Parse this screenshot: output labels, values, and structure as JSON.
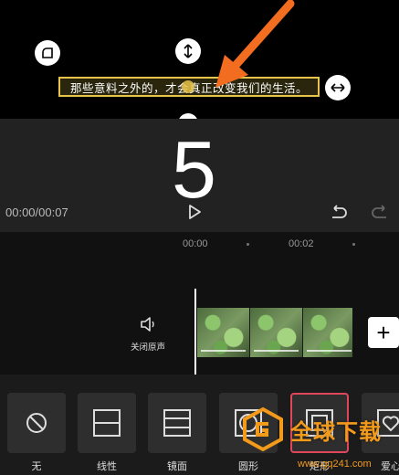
{
  "preview": {
    "caption": "那些意料之外的，才会真正改变我们的生活。"
  },
  "stage": {
    "big_number": "5",
    "time": "00:00/00:07"
  },
  "timeline": {
    "ticks": [
      "00:00",
      "00:02"
    ],
    "mute_label": "关闭原声",
    "add_label": "+"
  },
  "toolbar": {
    "items": [
      {
        "label": "无",
        "icon": "none-icon"
      },
      {
        "label": "线性",
        "icon": "linear-mask-icon"
      },
      {
        "label": "镜面",
        "icon": "mirror-mask-icon"
      },
      {
        "label": "圆形",
        "icon": "circle-mask-icon"
      },
      {
        "label": "矩形",
        "icon": "rectangle-mask-icon",
        "selected": true
      },
      {
        "label": "爱心",
        "icon": "heart-mask-icon"
      }
    ]
  },
  "watermark": {
    "text": "全球下载",
    "url": "www.gq241.com"
  },
  "colors": {
    "accent_arrow": "#f36d21",
    "caption_border": "#e8c44a",
    "selected_border": "#e0475a",
    "watermark": "#f39a1a"
  }
}
